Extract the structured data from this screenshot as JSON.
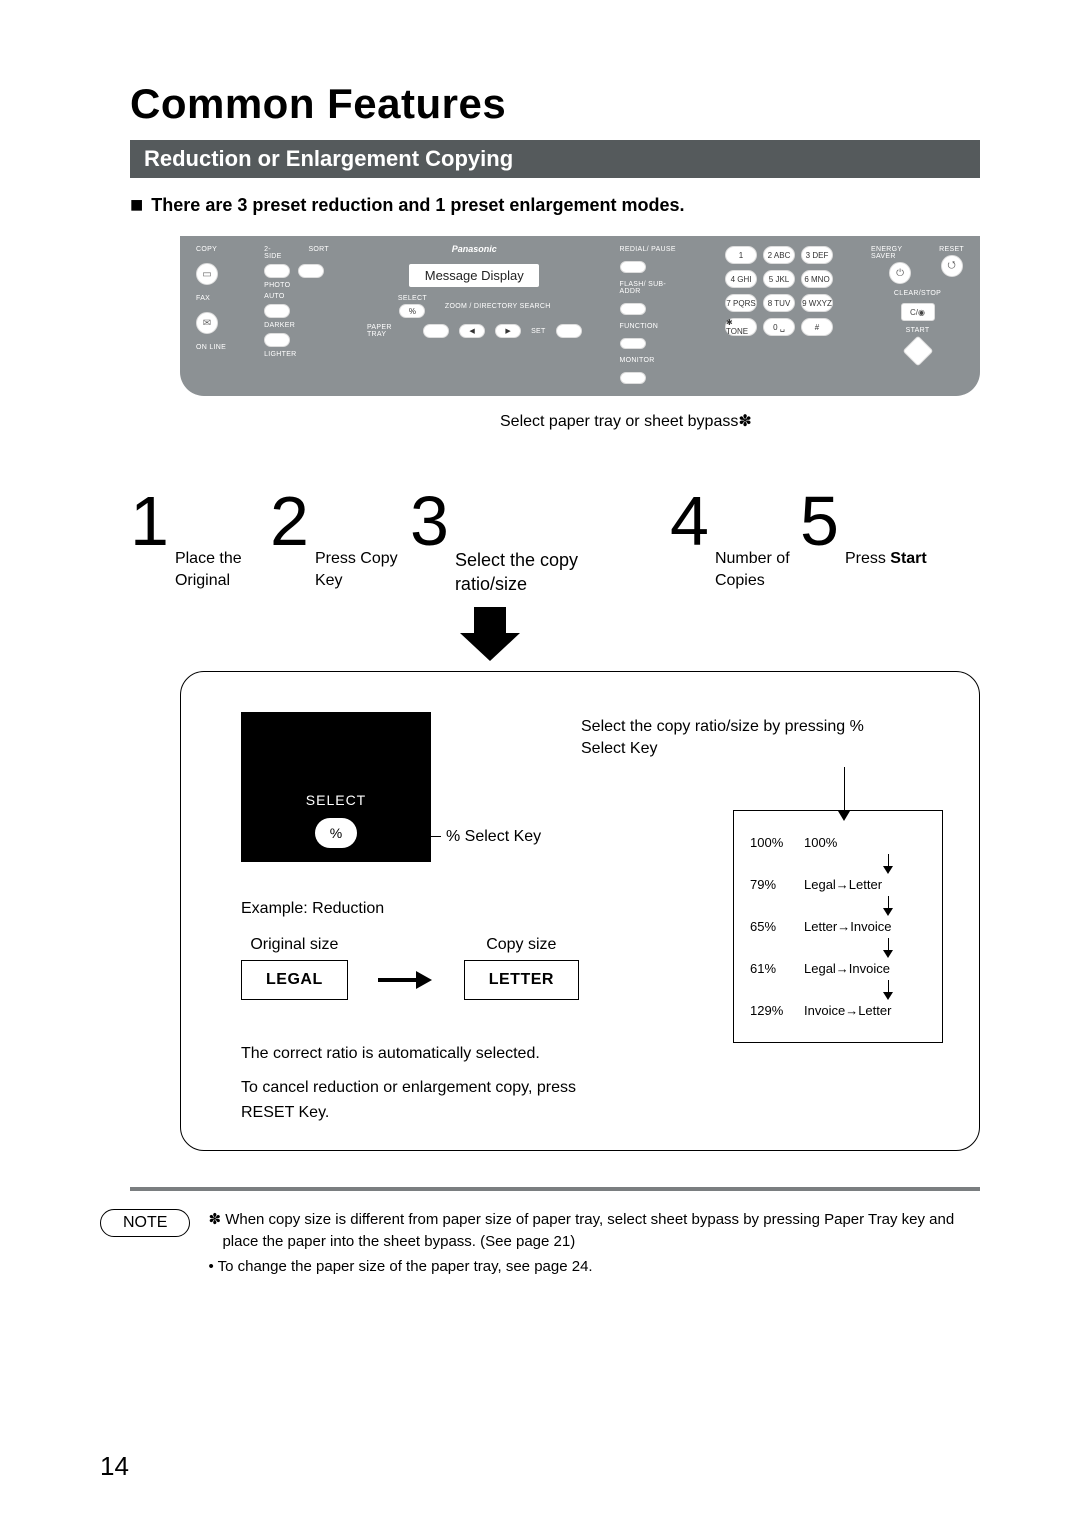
{
  "title": "Common Features",
  "subtitle": "Reduction or Enlargement Copying",
  "lead": "There are 3 preset reduction and 1 preset enlargement modes.",
  "panel": {
    "brand": "Panasonic",
    "message_display": "Message Display",
    "col1": {
      "copy": "COPY",
      "fax": "FAX",
      "online": "ON LINE"
    },
    "col2": {
      "twoside": "2-SIDE",
      "sort": "SORT",
      "photo": "PHOTO",
      "auto": "AUTO",
      "darker": "DARKER",
      "lighter": "LIGHTER"
    },
    "col3": {
      "select": "SELECT",
      "pct": "%",
      "zoom": "ZOOM",
      "dir": "DIRECTORY SEARCH",
      "tray": "PAPER TRAY",
      "set": "SET"
    },
    "col4": {
      "redial": "REDIAL/ PAUSE",
      "flash": "FLASH/ SUB-ADDR",
      "function": "FUNCTION",
      "monitor": "MONITOR"
    },
    "keypad": [
      "1",
      "2 ABC",
      "3 DEF",
      "4 GHI",
      "5 JKL",
      "6 MNO",
      "7 PQRS",
      "8 TUV",
      "9 WXYZ",
      "✱ TONE",
      "0 ␣",
      "#"
    ],
    "side": {
      "energy": "ENERGY SAVER",
      "reset": "RESET",
      "clear": "CLEAR/STOP",
      "clear_sym": "C/◉",
      "start": "START"
    }
  },
  "annot": {
    "tray": "Select paper tray or sheet bypass✽"
  },
  "steps": [
    {
      "num": "1",
      "text": "Place the\nOriginal"
    },
    {
      "num": "2",
      "text": "Press Copy\nKey"
    },
    {
      "num": "3",
      "text": "Select the copy\nratio/size"
    },
    {
      "num": "4",
      "text": "Number of\nCopies"
    },
    {
      "num": "5",
      "text": "Press Start",
      "bold": "Start"
    }
  ],
  "detail": {
    "select_label": "SELECT",
    "select_pct": "%",
    "select_key": "% Select Key",
    "right_text": "Select the copy ratio/size by pressing % Select Key",
    "example_label": "Example: Reduction",
    "original_size": "Original size",
    "copy_size": "Copy size",
    "legal": "LEGAL",
    "letter": "LETTER",
    "auto_line": "The correct ratio is automatically selected.",
    "cancel_line": "To cancel reduction or enlargement copy, press RESET Key.",
    "ratios": [
      {
        "pct": "100%",
        "desc": "100%"
      },
      {
        "pct": "79%",
        "desc": "Legal→Letter"
      },
      {
        "pct": "65%",
        "desc": "Letter→Invoice"
      },
      {
        "pct": "61%",
        "desc": "Legal→Invoice"
      },
      {
        "pct": "129%",
        "desc": "Invoice→Letter"
      }
    ]
  },
  "note": {
    "label": "NOTE",
    "items": [
      "✽ When copy size is different from paper size of paper tray, select sheet bypass by pressing Paper Tray key and place the paper into the sheet bypass. (See page 21)",
      "• To change the paper size of the paper tray, see page 24."
    ]
  },
  "page_number": "14"
}
